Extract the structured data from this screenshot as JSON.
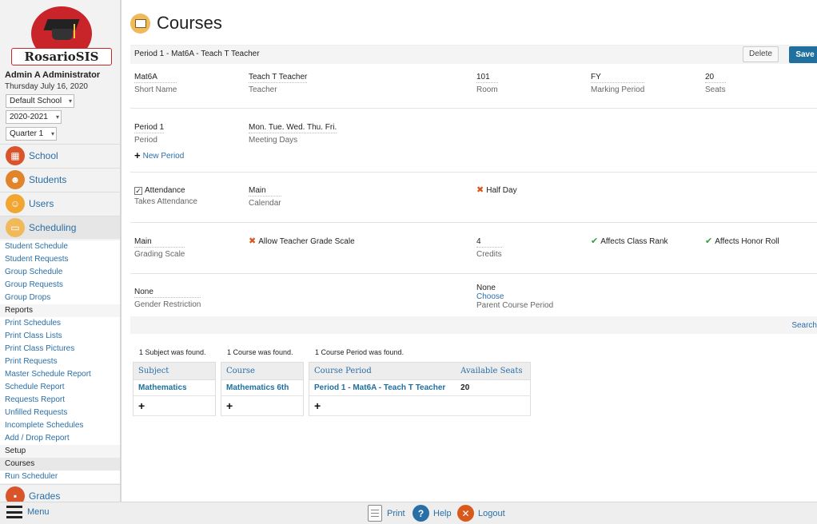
{
  "brand": {
    "name": "RosarioSIS",
    "accent": "#c8242a",
    "link_color": "#2a6ea6"
  },
  "user": {
    "name": "Admin A Administrator",
    "date": "Thursday July 16, 2020"
  },
  "selectors": {
    "school": "Default School",
    "year": "2020-2021",
    "quarter": "Quarter 1"
  },
  "modules": [
    {
      "label": "School",
      "icon": "school-icon"
    },
    {
      "label": "Students",
      "icon": "students-icon"
    },
    {
      "label": "Users",
      "icon": "users-icon"
    },
    {
      "label": "Scheduling",
      "icon": "scheduling-icon"
    },
    {
      "label": "Grades",
      "icon": "grades-icon"
    }
  ],
  "submenu": {
    "top": [
      "Student Schedule",
      "Student Requests",
      "Group Schedule",
      "Group Requests",
      "Group Drops"
    ],
    "reports_head": "Reports",
    "reports": [
      "Print Schedules",
      "Print Class Lists",
      "Print Class Pictures",
      "Print Requests",
      "Master Schedule Report",
      "Schedule Report",
      "Requests Report",
      "Unfilled Requests",
      "Incomplete Schedules",
      "Add / Drop Report"
    ],
    "setup_head": "Setup",
    "setup": [
      "Courses",
      "Run Scheduler"
    ]
  },
  "page": {
    "title": "Courses",
    "icon": "courses-book-icon"
  },
  "titlebar": {
    "text": "Period 1 - Mat6A - Teach T Teacher",
    "delete_label": "Delete",
    "save_label": "Save"
  },
  "fields": {
    "short_name": {
      "value": "Mat6A",
      "label": "Short Name"
    },
    "teacher": {
      "value": "Teach T Teacher",
      "label": "Teacher"
    },
    "room": {
      "value": "101",
      "label": "Room"
    },
    "marking_period": {
      "value": "FY",
      "label": "Marking Period"
    },
    "seats": {
      "value": "20",
      "label": "Seats"
    },
    "period": {
      "value": "Period 1",
      "label": "Period"
    },
    "meeting_days": {
      "value": "Mon. Tue. Wed. Thu. Fri.",
      "label": "Meeting Days"
    },
    "new_period_link": "New Period",
    "attendance": {
      "value": "Attendance",
      "label": "Takes Attendance",
      "checked": true
    },
    "calendar": {
      "value": "Main",
      "label": "Calendar"
    },
    "half_day": {
      "value": "Half Day"
    },
    "grading_scale": {
      "value": "Main",
      "label": "Grading Scale"
    },
    "allow_teacher_grade_scale": {
      "value": "Allow Teacher Grade Scale"
    },
    "credits": {
      "value": "4",
      "label": "Credits"
    },
    "affects_class_rank": {
      "value": "Affects Class Rank"
    },
    "affects_honor_roll": {
      "value": "Affects Honor Roll"
    },
    "gender_restriction": {
      "value": "None",
      "label": "Gender Restriction"
    },
    "parent_course_period": {
      "value": "None",
      "choose": "Choose",
      "label": "Parent Course Period"
    }
  },
  "search_link": "Search",
  "lists": {
    "subject": {
      "found": "1 Subject was found.",
      "header": "Subject",
      "items": [
        "Mathematics"
      ]
    },
    "course": {
      "found": "1 Course was found.",
      "header": "Course",
      "items": [
        "Mathematics 6th"
      ]
    },
    "course_period": {
      "found": "1 Course Period was found.",
      "headers": [
        "Course Period",
        "Available Seats"
      ],
      "rows": [
        {
          "name": "Period 1 - Mat6A - Teach T Teacher",
          "seats": "20"
        }
      ]
    },
    "add_symbol": "+"
  },
  "bottombar": {
    "menu": "Menu",
    "print": "Print",
    "help": "Help",
    "logout": "Logout"
  }
}
